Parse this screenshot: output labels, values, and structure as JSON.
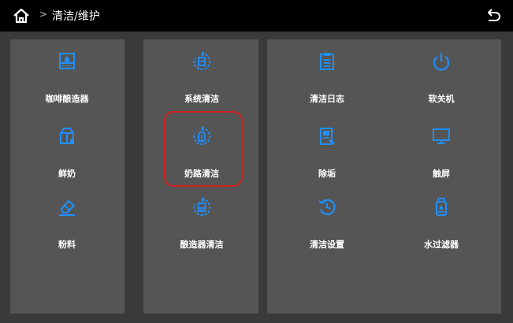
{
  "header": {
    "breadcrumb_sep": ">",
    "title": "清洁/维护",
    "home_icon": "home-icon",
    "back_icon": "back-arrow-icon"
  },
  "colors": {
    "accent": "#1e90ff",
    "header_bg": "#000000",
    "panel_bg": "#555555",
    "screen_bg": "#3a3a3a",
    "highlight": "#d42020"
  },
  "panels": [
    {
      "items": [
        {
          "label": "咖啡酿造器",
          "icon": "brewer-icon"
        },
        {
          "label": "鲜奶",
          "icon": "milk-carton-icon"
        },
        {
          "label": "粉料",
          "icon": "powder-eraser-icon"
        }
      ]
    },
    {
      "items": [
        {
          "label": "系统清洁",
          "icon": "system-clean-icon"
        },
        {
          "label": "奶路清洁",
          "icon": "milk-line-clean-icon"
        },
        {
          "label": "酿造器清洁",
          "icon": "brewer-clean-icon"
        }
      ]
    },
    {
      "items": [
        {
          "label": "清洁日志",
          "icon": "clipboard-icon"
        },
        {
          "label": "软关机",
          "icon": "power-icon"
        },
        {
          "label": "除垢",
          "icon": "descale-icon"
        },
        {
          "label": "触屏",
          "icon": "monitor-icon"
        },
        {
          "label": "清洁设置",
          "icon": "clean-settings-icon"
        },
        {
          "label": "水过滤器",
          "icon": "water-filter-icon"
        }
      ]
    }
  ]
}
